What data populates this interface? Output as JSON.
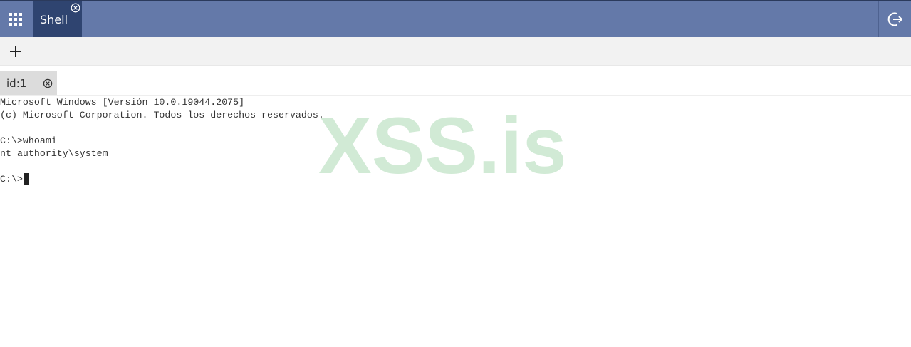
{
  "colors": {
    "topbar": "#6479a9",
    "active_tab": "#2f4470",
    "watermark": "#cfe9d3"
  },
  "header": {
    "apps_icon": "grid-icon",
    "active_app_tab": "Shell",
    "close_icon": "circle-x-icon",
    "logout_icon": "logout-icon"
  },
  "toolbar": {
    "add_icon": "plus-icon"
  },
  "sessions": {
    "tabs": [
      {
        "label": "id:1",
        "close_icon": "circle-x-icon"
      }
    ]
  },
  "terminal": {
    "lines": [
      "Microsoft Windows [Versión 10.0.19044.2075]",
      "(c) Microsoft Corporation. Todos los derechos reservados.",
      "",
      "C:\\>whoami",
      "nt authority\\system",
      ""
    ],
    "prompt": "C:\\>"
  },
  "watermark": {
    "text": "XSS.is"
  }
}
